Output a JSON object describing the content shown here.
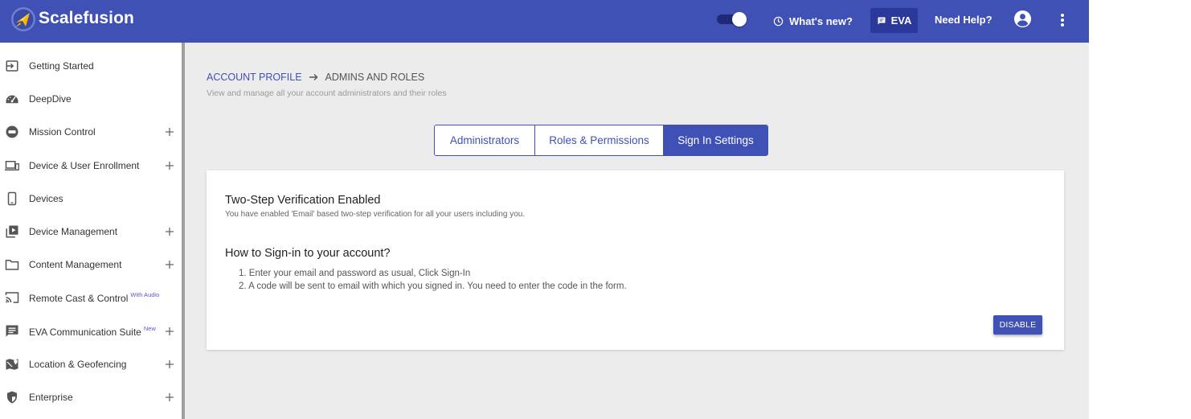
{
  "header": {
    "brand": "Scalefusion",
    "whats_new_label": "What's new?",
    "eva_label": "EVA",
    "need_help_label": "Need Help?",
    "toggle_state": "on",
    "color": "#3f51b5"
  },
  "sidebar": {
    "items": [
      {
        "label": "Getting Started",
        "icon": "login-icon",
        "expandable": false
      },
      {
        "label": "DeepDive",
        "icon": "speedometer-icon",
        "expandable": false
      },
      {
        "label": "Mission Control",
        "icon": "mission-control-icon",
        "expandable": true
      },
      {
        "label": "Device & User Enrollment",
        "icon": "devices-enroll-icon",
        "expandable": true
      },
      {
        "label": "Devices",
        "icon": "smartphone-icon",
        "expandable": false
      },
      {
        "label": "Device Management",
        "icon": "device-management-icon",
        "expandable": true
      },
      {
        "label": "Content Management",
        "icon": "folder-icon",
        "expandable": true
      },
      {
        "label": "Remote Cast & Control",
        "badge": "With Audio",
        "icon": "cast-icon",
        "expandable": false
      },
      {
        "label": "EVA Communication Suite",
        "badge": "New",
        "icon": "chat-icon",
        "expandable": true
      },
      {
        "label": "Location & Geofencing",
        "icon": "map-location-icon",
        "expandable": true
      },
      {
        "label": "Enterprise",
        "icon": "shield-icon",
        "expandable": true
      }
    ]
  },
  "breadcrumb": {
    "parent": "ACCOUNT PROFILE",
    "current": "ADMINS AND ROLES"
  },
  "subtitle": "View and manage all your account administrators and their roles",
  "tabs": [
    {
      "label": "Administrators",
      "active": false
    },
    {
      "label": "Roles & Permissions",
      "active": false
    },
    {
      "label": "Sign In Settings",
      "active": true
    }
  ],
  "card": {
    "title": "Two-Step Verification Enabled",
    "description": "You have enabled 'Email' based two-step verification for all your users including you.",
    "how_to_title": "How to Sign-in to your account?",
    "steps": [
      "1. Enter your email and password as usual, Click Sign-In",
      "2. A code will be sent to email with which you signed in. You need to enter the code in the form."
    ],
    "disable_label": "DISABLE"
  }
}
